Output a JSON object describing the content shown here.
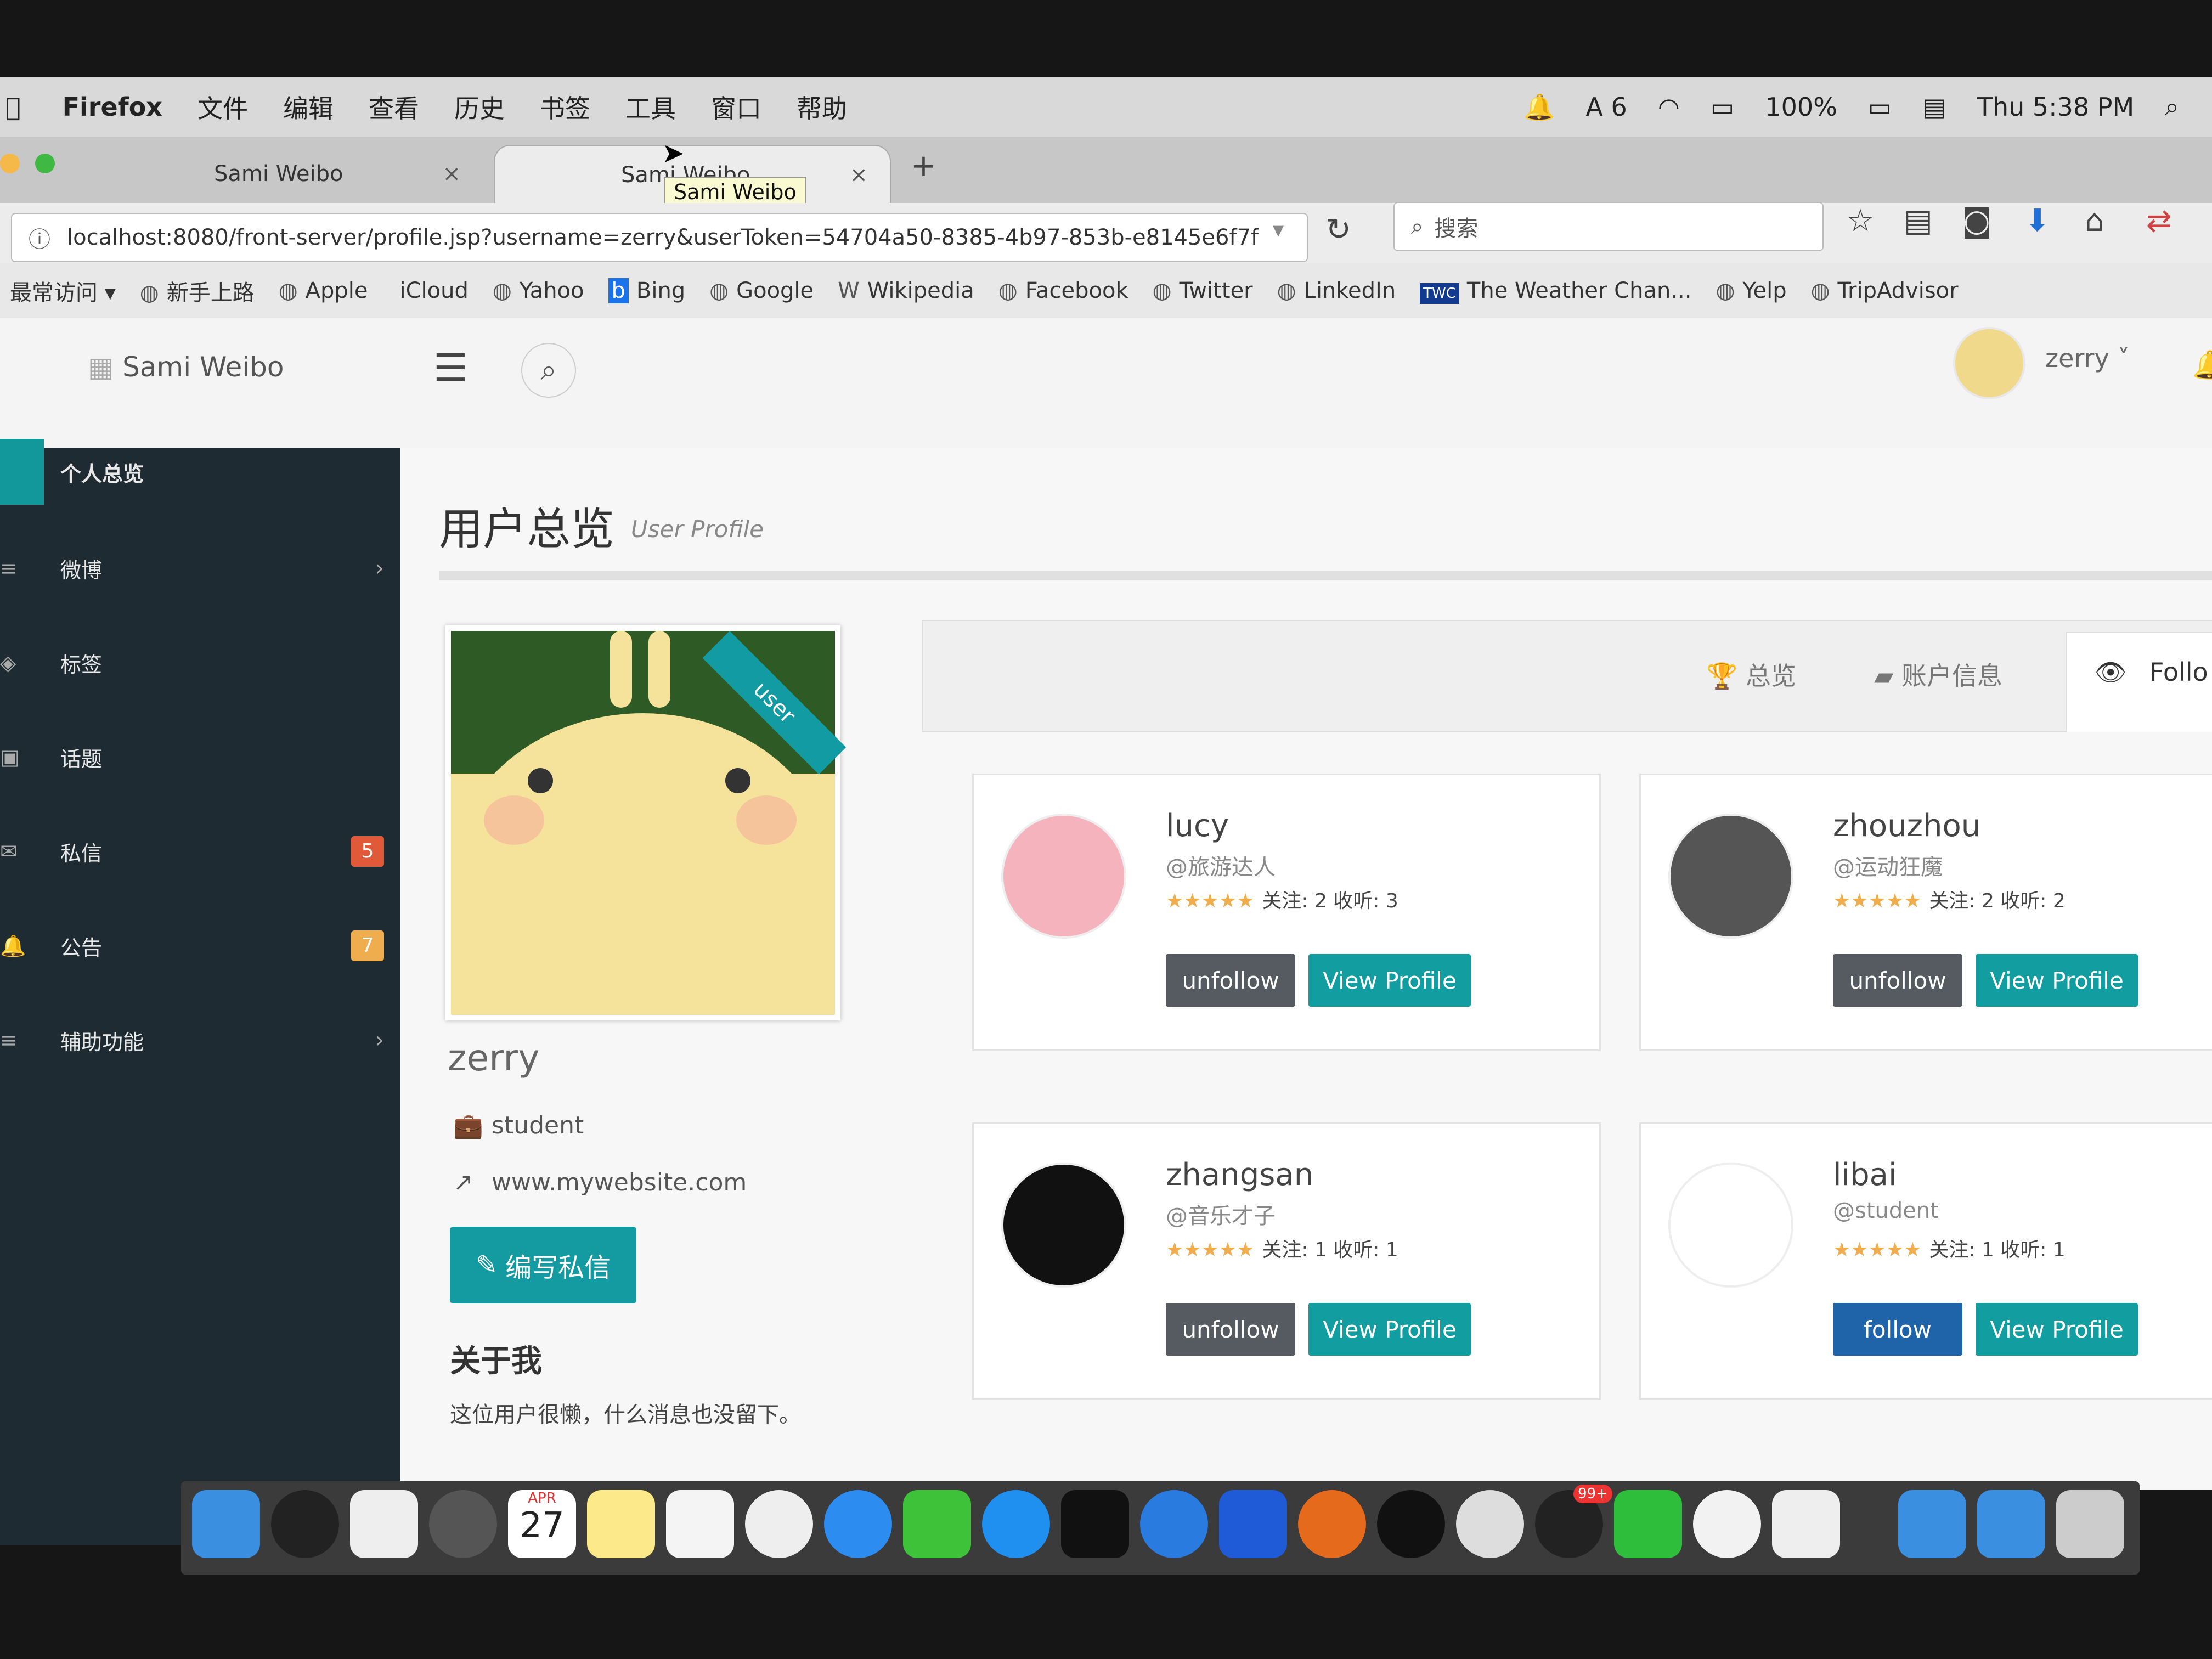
{
  "menubar": {
    "apple": "",
    "app": "Firefox",
    "items": [
      "文件",
      "编辑",
      "查看",
      "历史",
      "书签",
      "工具",
      "窗口",
      "帮助"
    ],
    "status": {
      "badge_count": "6",
      "battery": "100%",
      "clock": "Thu 5:38 PM"
    }
  },
  "browser": {
    "tabs": [
      {
        "label": "Sami Weibo",
        "close": "×"
      },
      {
        "label": "Sami Weibo",
        "close": "×"
      }
    ],
    "new_tab": "+",
    "tooltip": "Sami Weibo",
    "url": "localhost:8080/front-server/profile.jsp?username=zerry&userToken=54704a50-8385-4b97-853b-e8145e6f7f",
    "search_placeholder": "搜索",
    "bookmarks": [
      "最常访问",
      "新手上路",
      "Apple",
      "iCloud",
      "Yahoo",
      "Bing",
      "Google",
      "Wikipedia",
      "Facebook",
      "Twitter",
      "LinkedIn",
      "The Weather Chan...",
      "Yelp",
      "TripAdvisor"
    ]
  },
  "header": {
    "brand": "Sami Weibo",
    "user": "zerry"
  },
  "sidebar": {
    "items": [
      {
        "label": "个人总览",
        "icon": "home-icon"
      },
      {
        "label": "微博",
        "icon": "list-icon",
        "chevron": "›"
      },
      {
        "label": "标签",
        "icon": "tag-icon"
      },
      {
        "label": "话题",
        "icon": "gift-icon"
      },
      {
        "label": "私信",
        "icon": "envelope-icon",
        "badge": "5"
      },
      {
        "label": "公告",
        "icon": "bell-icon",
        "badge": "7"
      },
      {
        "label": "辅助功能",
        "icon": "list-icon",
        "chevron": "›"
      }
    ],
    "badge_colors": [
      "#e05a3a",
      "#f0ad4e"
    ]
  },
  "page": {
    "title": "用户总览",
    "subtitle": "User Profile"
  },
  "profile": {
    "ribbon": "user",
    "name": "zerry",
    "job": "student",
    "website": "www.mywebsite.com",
    "message_button": "编写私信",
    "about_heading": "关于我",
    "about_text": "这位用户很懒，什么消息也没留下。"
  },
  "panel_tabs": [
    "总览",
    "账户信息",
    "Follo"
  ],
  "follows": [
    {
      "name": "lucy",
      "handle": "@旅游达人",
      "stats": "关注: 2 收听: 3",
      "action": "unfollow",
      "view": "View Profile",
      "avatar_color": "#f5b3bd"
    },
    {
      "name": "zhouzhou",
      "handle": "@运动狂魔",
      "stats": "关注: 2 收听: 2",
      "action": "unfollow",
      "view": "View Profile",
      "avatar_color": "#555555"
    },
    {
      "name": "zhangsan",
      "handle": "@音乐才子",
      "stats": "关注: 1 收听: 1",
      "action": "unfollow",
      "view": "View Profile",
      "avatar_color": "#111111"
    },
    {
      "name": "libai",
      "handle": "@student",
      "stats": "关注: 1 收听: 1",
      "action": "follow",
      "view": "View Profile",
      "avatar_color": "#ffffff"
    }
  ],
  "stars": "★★★★★",
  "dock": {
    "calendar_month": "APR",
    "calendar_day": "27",
    "qq_badge": "99+"
  }
}
